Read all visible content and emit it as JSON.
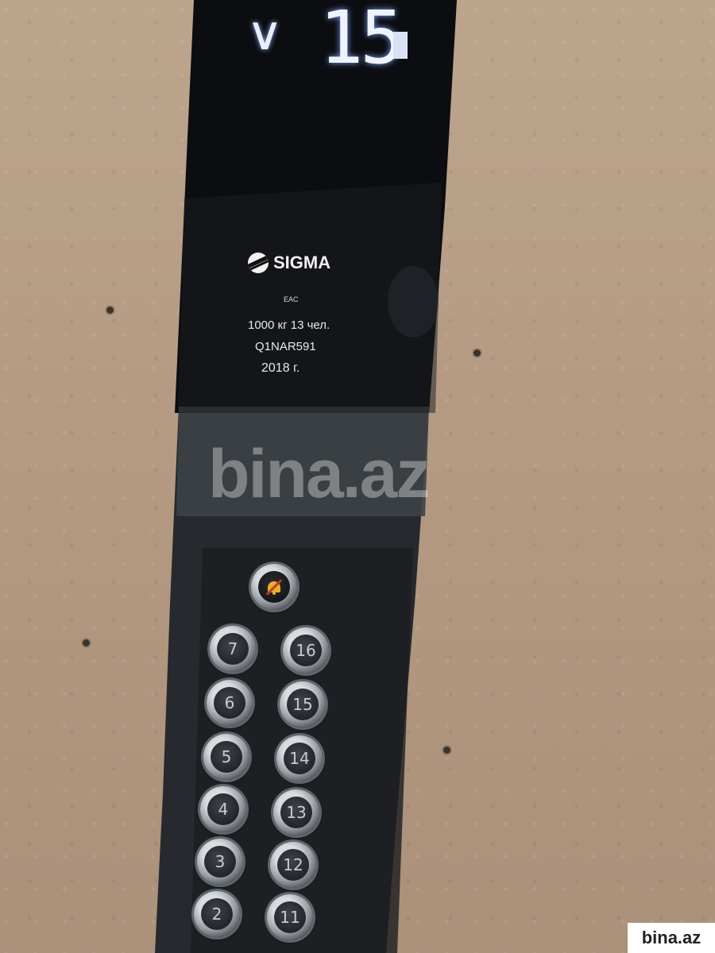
{
  "display": {
    "direction": "∨",
    "floor": "15"
  },
  "brand": {
    "name": "SIGMA",
    "mark": "EAC"
  },
  "spec": {
    "load": "1000  кг  13 чел.",
    "serial": "Q1NAR591",
    "year": "2018  г."
  },
  "buttons": {
    "alarm": {
      "icon": "alarm-bell-icon"
    },
    "left": [
      "7",
      "6",
      "5",
      "4",
      "3",
      "2"
    ],
    "right": [
      "16",
      "15",
      "14",
      "13",
      "12",
      "11"
    ]
  },
  "watermark": "bina.az",
  "badge": "bina.az"
}
